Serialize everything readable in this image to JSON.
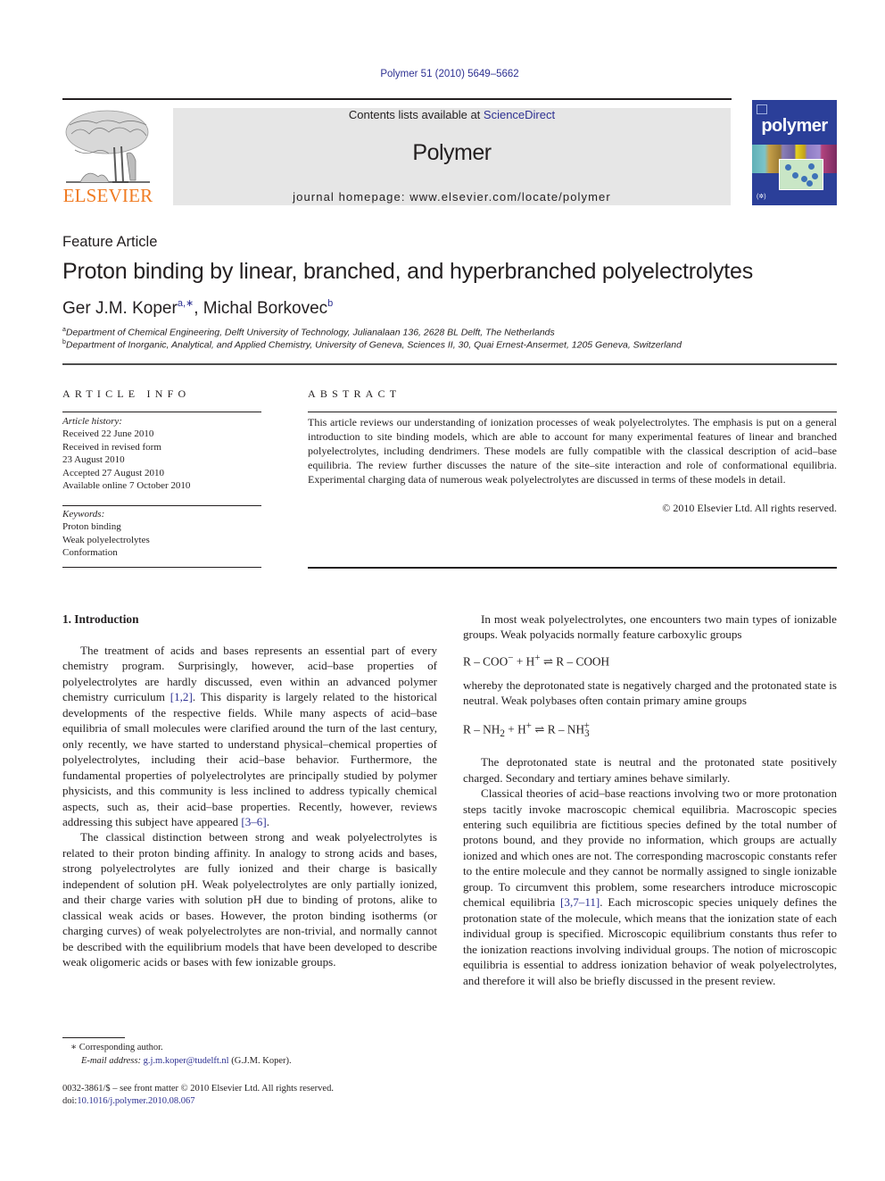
{
  "header": {
    "journal_ref": "Polymer 51 (2010) 5649–5662",
    "contents_prefix": "Contents lists available at ",
    "contents_link": "ScienceDirect",
    "journal_title": "Polymer",
    "homepage": "journal homepage: www.elsevier.com/locate/polymer",
    "publisher_logo_text": "ELSEVIER",
    "cover_title": "polymer",
    "colors": {
      "publisher_orange": "#f07b22",
      "link_blue": "#2e3192",
      "masthead_gray": "#e6e6e6",
      "cover_blue": "#2b3f99"
    }
  },
  "article": {
    "type": "Feature Article",
    "title": "Proton binding by linear, branched, and hyperbranched polyelectrolytes",
    "authors": [
      {
        "name": "Ger J.M. Koper",
        "sup": "a,∗"
      },
      {
        "name": "Michal Borkovec",
        "sup": "b"
      }
    ],
    "author_separator": ", ",
    "affiliations": [
      {
        "sup": "a",
        "text": "Department of Chemical Engineering, Delft University of Technology, Julianalaan 136, 2628 BL Delft, The Netherlands"
      },
      {
        "sup": "b",
        "text": "Department of Inorganic, Analytical, and Applied Chemistry, University of Geneva, Sciences II, 30, Quai Ernest-Ansermet, 1205 Geneva, Switzerland"
      }
    ]
  },
  "article_info": {
    "heading": "ARTICLE INFO",
    "history_label": "Article history:",
    "history": [
      "Received 22 June 2010",
      "Received in revised form",
      "23 August 2010",
      "Accepted 27 August 2010",
      "Available online 7 October 2010"
    ],
    "keywords_label": "Keywords:",
    "keywords": [
      "Proton binding",
      "Weak polyelectrolytes",
      "Conformation"
    ]
  },
  "abstract": {
    "heading": "ABSTRACT",
    "text": "This article reviews our understanding of ionization processes of weak polyelectrolytes. The emphasis is put on a general introduction to site binding models, which are able to account for many experimental features of linear and branched polyelectrolytes, including dendrimers. These models are fully compatible with the classical description of acid–base equilibria. The review further discusses the nature of the site–site interaction and role of conformational equilibria. Experimental charging data of numerous weak polyelectrolytes are discussed in terms of these models in detail.",
    "copyright": "© 2010 Elsevier Ltd. All rights reserved."
  },
  "body": {
    "section_heading": "1.  Introduction",
    "left": {
      "p1_a": "The treatment of acids and bases represents an essential part of every chemistry program. Surprisingly, however, acid–base properties of polyelectrolytes are hardly discussed, even within an advanced polymer chemistry curriculum ",
      "p1_ref1": "[1,2]",
      "p1_b": ". This disparity is largely related to the historical developments of the respective fields. While many aspects of acid–base equilibria of small molecules were clarified around the turn of the last century, only recently, we have started to understand physical–chemical properties of polyelectrolytes, including their acid–base behavior. Furthermore, the fundamental properties of polyelectrolytes are principally studied by polymer physicists, and this community is less inclined to address typically chemical aspects, such as, their acid–base properties. Recently, however, reviews addressing this subject have appeared ",
      "p1_ref2": "[3–6]",
      "p1_c": ".",
      "p2": "The classical distinction between strong and weak polyelectrolytes is related to their proton binding affinity. In analogy to strong acids and bases, strong polyelectrolytes are fully ionized and their charge is basically independent of solution pH. Weak polyelectrolytes are only partially ionized, and their charge varies with solution pH due to binding of protons, alike to classical weak acids or bases. However, the proton binding isotherms (or charging curves) of weak polyelectrolytes are non-trivial, and normally cannot be described with the equilibrium models that have been developed to describe weak oligomeric acids or bases with few ionizable groups."
    },
    "right": {
      "p1": "In most weak polyelectrolytes, one encounters two main types of ionizable groups. Weak polyacids normally feature carboxylic groups",
      "eq1": {
        "lhs": "R – COO",
        "lhs_sup": "−",
        "plus": " + H",
        "plus_sup": "+",
        "arrow": " ⇌ ",
        "rhs": "R – COOH"
      },
      "p2": "whereby the deprotonated state is negatively charged and the protonated state is neutral. Weak polybases often contain primary amine groups",
      "eq2": {
        "lhs": "R – NH",
        "lhs_sub": "2",
        "plus": " + H",
        "plus_sup": "+",
        "arrow": " ⇌ ",
        "rhs": "R – NH",
        "rhs_sub": "3",
        "rhs_sup": "+"
      },
      "p3": "The deprotonated state is neutral and the protonated state positively charged. Secondary and tertiary amines behave similarly.",
      "p4_a": "Classical theories of acid–base reactions involving two or more protonation steps tacitly invoke macroscopic chemical equilibria. Macroscopic species entering such equilibria are fictitious species defined by the total number of protons bound, and they provide no information, which groups are actually ionized and which ones are not. The corresponding macroscopic constants refer to the entire molecule and they cannot be normally assigned to single ionizable group. To circumvent this problem, some researchers introduce microscopic chemical equilibria ",
      "p4_ref": "[3,7–11]",
      "p4_b": ". Each microscopic species uniquely defines the protonation state of the molecule, which means that the ionization state of each individual group is specified. Microscopic equilibrium constants thus refer to the ionization reactions involving individual groups. The notion of microscopic equilibria is essential to address ionization behavior of weak polyelectrolytes, and therefore it will also be briefly discussed in the present review."
    }
  },
  "footnotes": {
    "corresponding_mark": "∗",
    "corresponding_text": "Corresponding author.",
    "email_label": "E-mail address:",
    "email": "g.j.m.koper@tudelft.nl",
    "email_suffix": " (G.J.M. Koper).",
    "front_matter": "0032-3861/$ – see front matter © 2010 Elsevier Ltd. All rights reserved.",
    "doi_label": "doi:",
    "doi": "10.1016/j.polymer.2010.08.067"
  }
}
